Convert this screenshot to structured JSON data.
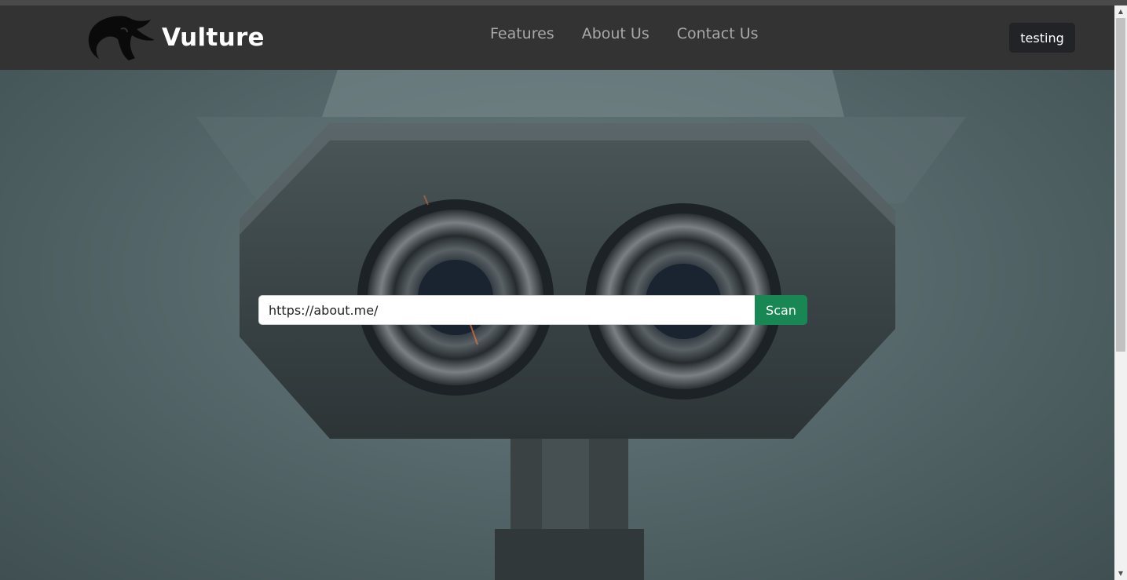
{
  "brand": {
    "name": "Vulture",
    "logo_icon": "vulture-head-icon"
  },
  "nav": {
    "items": [
      {
        "label": "Features"
      },
      {
        "label": "About Us"
      },
      {
        "label": "Contact Us"
      }
    ]
  },
  "user": {
    "label": "testing"
  },
  "search": {
    "value": "https://about.me/",
    "button_label": "Scan"
  },
  "colors": {
    "navbar_bg": "#333333",
    "nav_link": "#a9a9a9",
    "user_button_bg": "#212326",
    "scan_button_bg": "#198754"
  },
  "icons": {
    "scroll_up": "▲",
    "scroll_down": "▼"
  }
}
